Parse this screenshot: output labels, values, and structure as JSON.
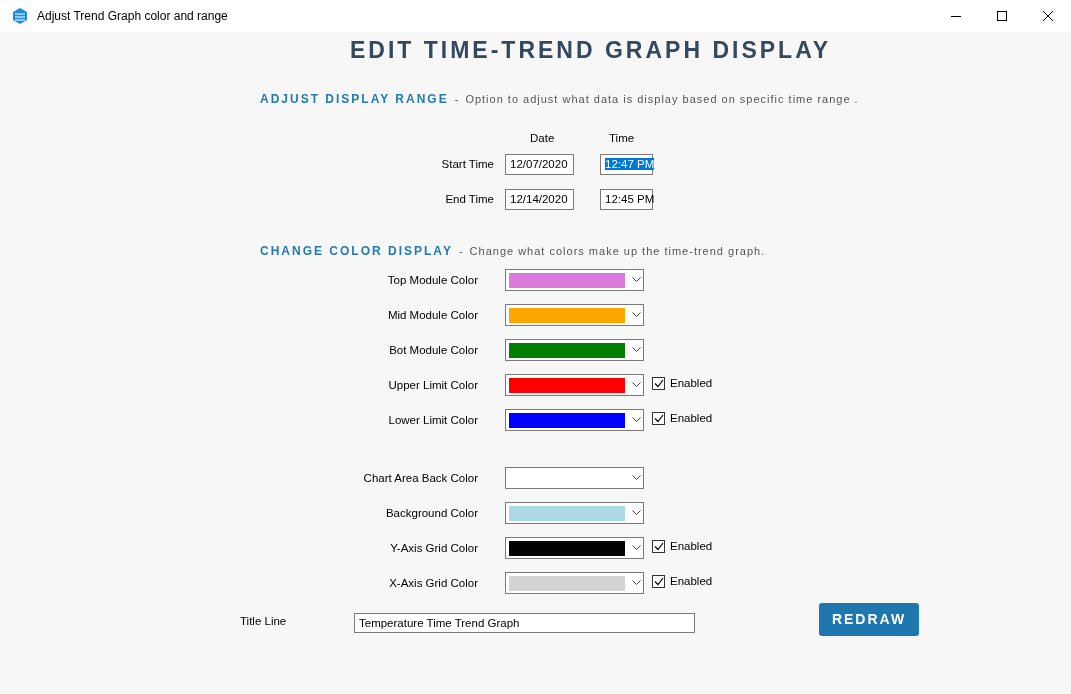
{
  "window": {
    "title": "Adjust Trend Graph color and range"
  },
  "heading": "EDIT TIME-TREND GRAPH DISPLAY",
  "range_section": {
    "title": "ADJUST DISPLAY RANGE",
    "separator": "-",
    "description": "Option to adjust what data is display based on specific time range .",
    "columns": [
      "Date",
      "Time"
    ],
    "rows": [
      {
        "label": "Start Time",
        "date": "12/07/2020",
        "time": "12:47 PM",
        "time_highlighted": true
      },
      {
        "label": "End Time",
        "date": "12/14/2020",
        "time": "12:45 PM",
        "time_highlighted": false
      }
    ]
  },
  "color_section": {
    "title": "CHANGE COLOR DISPLAY",
    "separator": "-",
    "description": "Change what colors make up the time-trend graph.",
    "groups": [
      [
        {
          "label": "Top Module Color",
          "color": "#da7ada"
        },
        {
          "label": "Mid Module Color",
          "color": "#ffa500"
        },
        {
          "label": "Bot Module Color",
          "color": "#008000"
        },
        {
          "label": "Upper Limit Color",
          "color": "#ff0000",
          "checkbox": {
            "label": "Enabled",
            "checked": true
          }
        },
        {
          "label": "Lower Limit Color",
          "color": "#0000ff",
          "checkbox": {
            "label": "Enabled",
            "checked": true
          }
        }
      ],
      [
        {
          "label": "Chart Area Back Color",
          "color": "#ffffff"
        },
        {
          "label": "Background Color",
          "color": "#add8e6"
        },
        {
          "label": "Y-Axis Grid Color",
          "color": "#000000",
          "checkbox": {
            "label": "Enabled",
            "checked": true
          }
        },
        {
          "label": "X-Axis Grid Color",
          "color": "#d3d3d3",
          "checkbox": {
            "label": "Enabled",
            "checked": true
          }
        }
      ]
    ]
  },
  "title_line": {
    "label": "Title Line",
    "value": "Temperature Time Trend Graph"
  },
  "redraw_button": "REDRAW"
}
